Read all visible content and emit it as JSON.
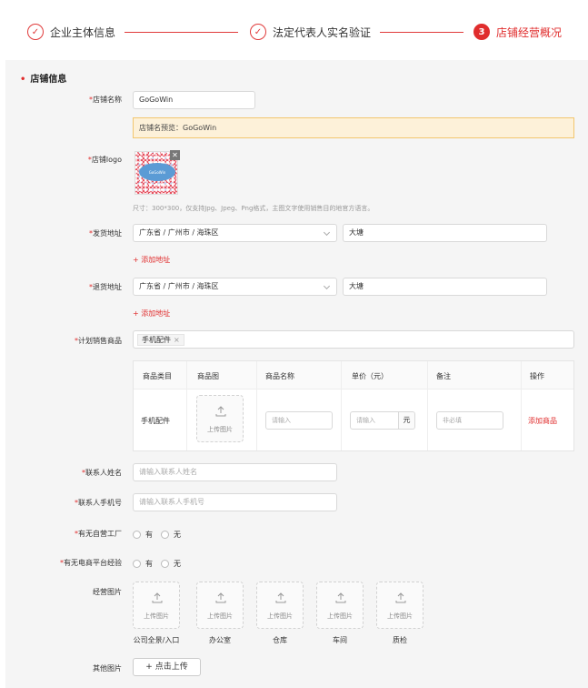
{
  "steps": [
    {
      "label": "企业主体信息",
      "icon": "check-icon"
    },
    {
      "label": "法定代表人实名验证",
      "icon": "check-icon"
    },
    {
      "number": "3",
      "label": "店铺经营概况"
    }
  ],
  "section_title": "店铺信息",
  "shop_name": {
    "label": "店铺名称",
    "value": "GoGoWin",
    "preview": "店铺名预览：GoGoWin"
  },
  "logo": {
    "label": "店铺logo",
    "logo_text": "GoGoWin",
    "hint": "尺寸：300*300，仅支持Jpg、Jpeg、Png格式，主图文字使用销售目的地官方语言。"
  },
  "ship_address": {
    "label": "发货地址",
    "region": "广东省 / 广州市 / 海珠区",
    "detail": "大塘",
    "add_label": "+ 添加地址"
  },
  "return_address": {
    "label": "退货地址",
    "region": "广东省 / 广州市 / 海珠区",
    "detail": "大塘",
    "add_label": "+ 添加地址"
  },
  "planned_goods": {
    "label": "计划销售商品",
    "tag": "手机配件",
    "tag_close": "×",
    "table": {
      "headers": [
        "商品类目",
        "商品图",
        "商品名称",
        "单价（元）",
        "备注",
        "操作"
      ],
      "row": {
        "category": "手机配件",
        "image_upload": "上传图片",
        "name_placeholder": "请输入",
        "price_placeholder": "请输入",
        "price_unit": "元",
        "note_placeholder": "非必填",
        "action": "添加商品"
      }
    }
  },
  "contact_name": {
    "label": "联系人姓名",
    "placeholder": "请输入联系人姓名"
  },
  "contact_phone": {
    "label": "联系人手机号",
    "placeholder": "请输入联系人手机号"
  },
  "own_factory": {
    "label": "有无自营工厂",
    "yes": "有",
    "no": "无"
  },
  "ecom_experience": {
    "label": "有无电商平台经验",
    "yes": "有",
    "no": "无"
  },
  "business_images": {
    "label": "经营图片",
    "upload_text": "上传图片",
    "items": [
      "公司全景/入口",
      "办公室",
      "仓库",
      "车间",
      "质检"
    ]
  },
  "other_images": {
    "label": "其他图片",
    "button": "+ 点击上传"
  }
}
